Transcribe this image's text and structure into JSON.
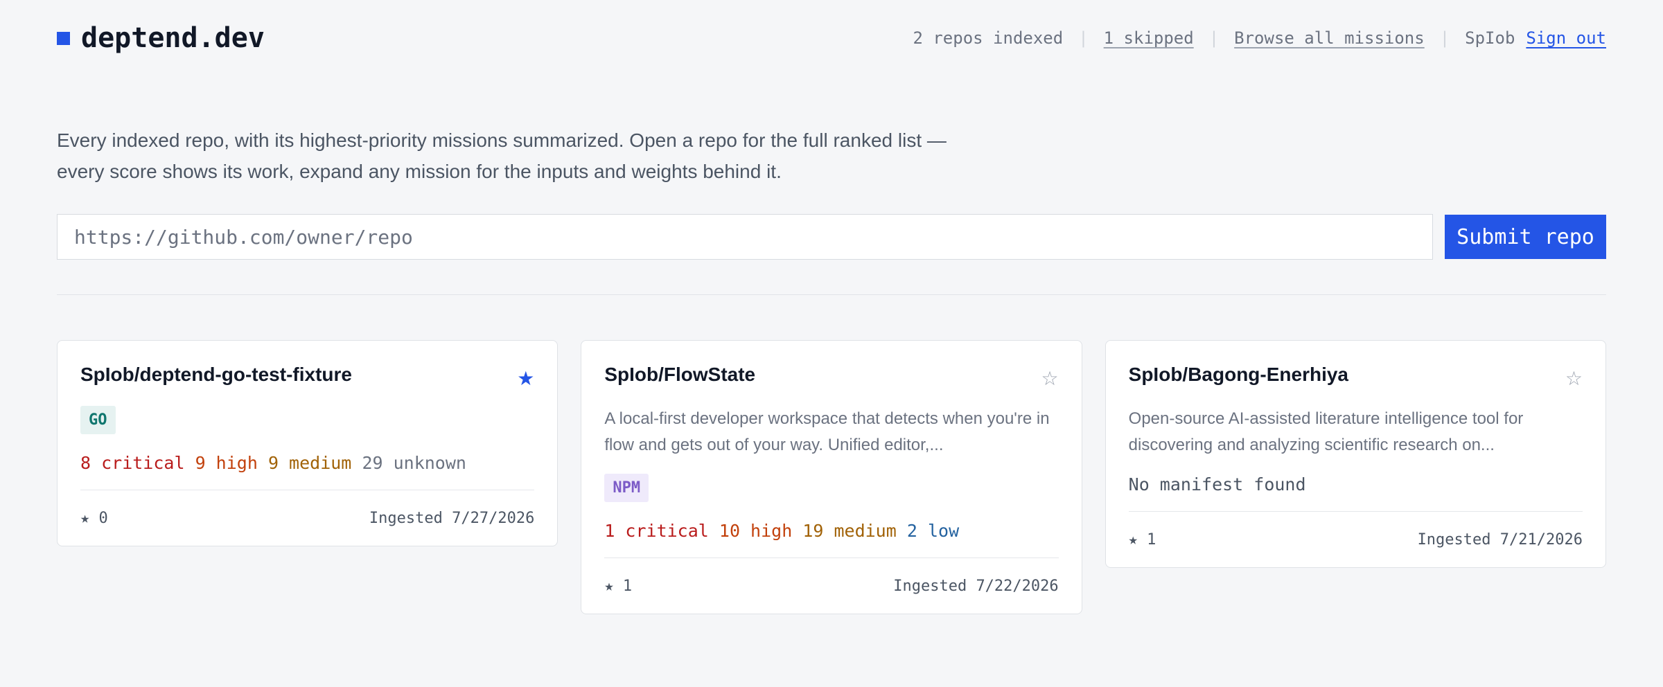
{
  "header": {
    "brand": "deptend.dev",
    "repos_indexed": "2 repos indexed",
    "skipped": "1 skipped",
    "browse": "Browse all missions",
    "user": "SpIob",
    "sign_out": "Sign out"
  },
  "intro": {
    "line1": "Every indexed repo, with its highest-priority missions summarized. Open a repo for the full ranked list —",
    "line2": "every score shows its work, expand any mission for the inputs and weights behind it."
  },
  "submit": {
    "placeholder": "https://github.com/owner/repo",
    "button": "Submit repo"
  },
  "cards": [
    {
      "title": "SpIob/deptend-go-test-fixture",
      "star": "★",
      "badge": "GO",
      "counts": {
        "critical": "8 critical",
        "high": "9 high",
        "medium": "9 medium",
        "unknown": "29 unknown"
      },
      "stars": "★ 0",
      "ingested": "Ingested 7/27/2026"
    },
    {
      "title": "SpIob/FlowState",
      "star": "☆",
      "desc": "A local-first developer workspace that detects when you're in flow and gets out of your way. Unified editor,...",
      "badge": "NPM",
      "counts": {
        "critical": "1 critical",
        "high": "10 high",
        "medium": "19 medium",
        "low": "2 low"
      },
      "stars": "★ 1",
      "ingested": "Ingested 7/22/2026"
    },
    {
      "title": "SpIob/Bagong-Enerhiya",
      "star": "☆",
      "desc": "Open-source AI-assisted literature intelligence tool for discovering and analyzing scientific research on...",
      "no_manifest": "No manifest found",
      "stars": "★ 1",
      "ingested": "Ingested 7/21/2026"
    }
  ],
  "colors": {
    "accent": "#2455e6",
    "critical": "#b91c1c",
    "high": "#c2410c",
    "medium": "#a16207",
    "low": "#2563a0"
  }
}
